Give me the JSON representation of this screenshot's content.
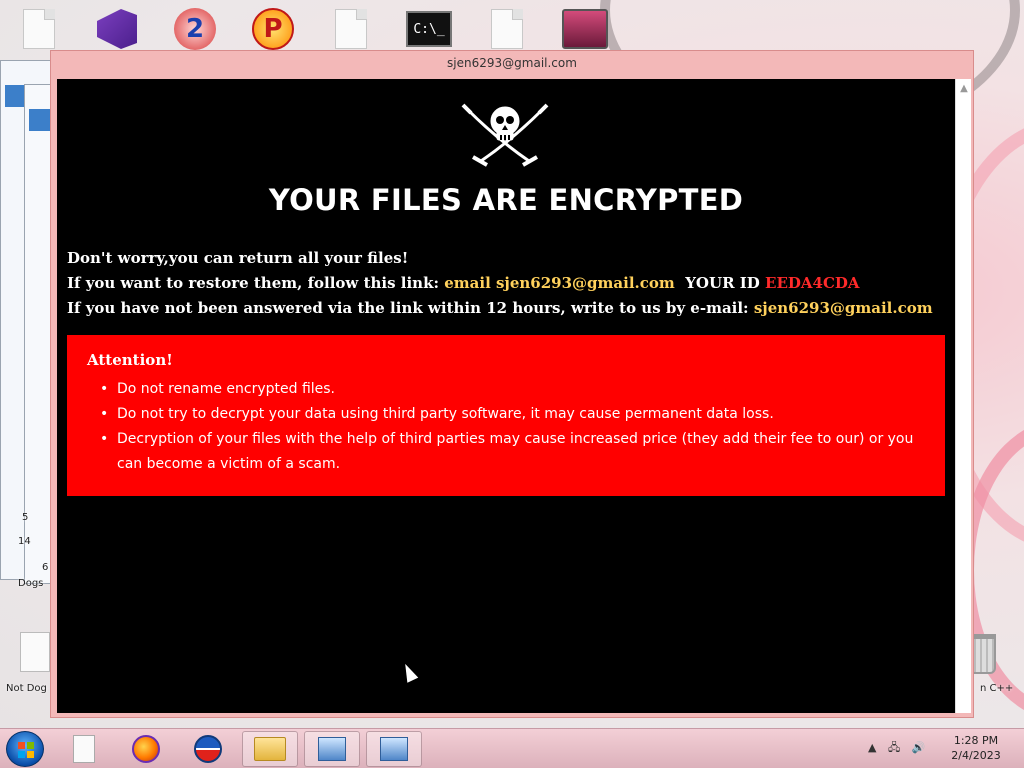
{
  "window": {
    "title": "sjen6293@gmail.com"
  },
  "ransom": {
    "headline": "YOUR FILES ARE ENCRYPTED",
    "line1": "Don't worry,you can return all your files!",
    "line2_prefix": "If you want to restore them, follow this link: ",
    "line2_email": "email sjen6293@gmail.com",
    "line2_id_label": "YOUR ID",
    "line2_id_value": "EEDA4CDA",
    "line3_prefix": "If you have not been answered via the link within 12 hours, write to us by e-mail: ",
    "line3_email": "sjen6293@gmail.com",
    "attention_title": "Attention!",
    "attention_items": [
      "Do not rename encrypted files.",
      "Do not try to decrypt your data using third party software, it may cause permanent data loss.",
      "Decryption of your files with the help of third parties may cause increased price (they add their fee to our) or you can become a victim of a scam."
    ],
    "colors": {
      "background": "#000000",
      "accent_yellow": "#ffd15c",
      "id_red": "#ff2a2a",
      "attention_bg": "#ff0000"
    }
  },
  "desktop": {
    "top_icons": [
      "file-icon",
      "visual-studio-icon",
      "app-2-icon",
      "app-p-icon",
      "file-icon",
      "cmd-icon",
      "file-icon",
      "tv-app-icon"
    ],
    "cmd_glyph": "C:\\_",
    "left_labels": {
      "dogs": "Dogs",
      "not_dogs": "Not Dog",
      "label_14": "14",
      "label_6": "6",
      "label_5": "5"
    },
    "right_label": "n C++"
  },
  "taskbar": {
    "items": [
      "file-icon",
      "firefox-icon",
      "opera-icon",
      "explorer-folder-icon",
      "network-app-icon",
      "network-app-icon"
    ],
    "clock_time": "1:28 PM",
    "clock_date": "2/4/2023"
  }
}
